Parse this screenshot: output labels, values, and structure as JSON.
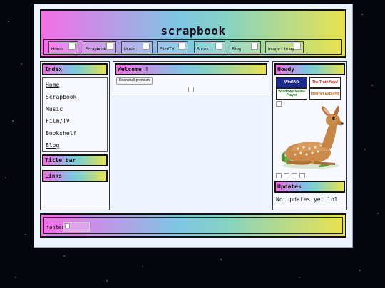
{
  "site": {
    "title": "scrapbook"
  },
  "nav": {
    "items": [
      {
        "label": "Home"
      },
      {
        "label": "Scrapbook"
      },
      {
        "label": "Music"
      },
      {
        "label": "Film/TV"
      },
      {
        "label": "Books"
      },
      {
        "label": "Blog"
      },
      {
        "label": "Image Library"
      }
    ]
  },
  "left": {
    "index_title": "Index",
    "links": [
      "Home",
      "Scrapbook",
      "Music",
      "Film/TV",
      "Bookshelf",
      "Blog"
    ],
    "titlebar_title": "Title bar",
    "links_title": "Links"
  },
  "center": {
    "welcome_title": "Welcome !",
    "button_label": "Deanshall premium"
  },
  "right": {
    "howdy_title": "Howdy",
    "badges": [
      {
        "text": "WinRAR",
        "color": "#1b2a8c"
      },
      {
        "text": "The Truth Now!",
        "color": "#e01a1a"
      },
      {
        "text": "Windows Media Player",
        "color": "#1e7d1e"
      },
      {
        "text": "Internet Explorer",
        "color": "#c06010"
      }
    ],
    "updates_title": "Updates",
    "updates_text": "No updates yet lol"
  },
  "footer": {
    "text": "footer"
  }
}
